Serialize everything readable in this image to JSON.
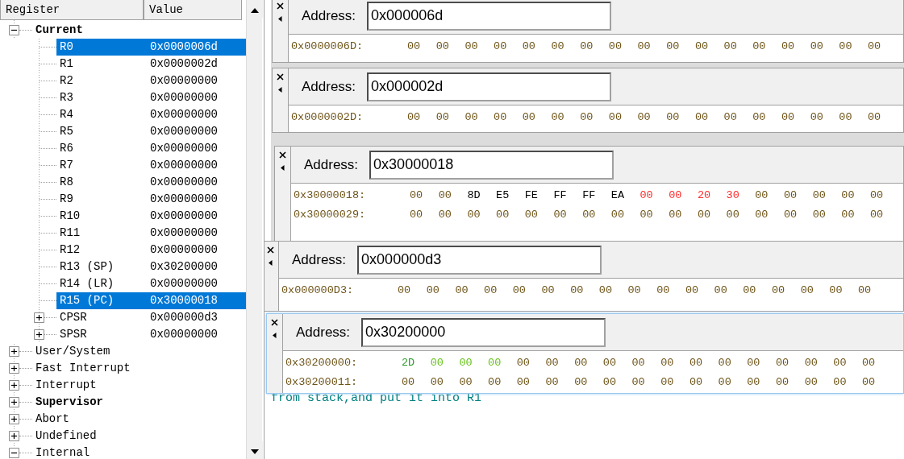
{
  "register_panel": {
    "columns": [
      "Register",
      "Value"
    ],
    "tree": [
      {
        "label": "Current",
        "bold": true,
        "expanded": true,
        "selected": false,
        "children": [
          {
            "label": "R0",
            "value": "0x0000006d",
            "selected": true
          },
          {
            "label": "R1",
            "value": "0x0000002d",
            "selected": false
          },
          {
            "label": "R2",
            "value": "0x00000000",
            "selected": false
          },
          {
            "label": "R3",
            "value": "0x00000000",
            "selected": false
          },
          {
            "label": "R4",
            "value": "0x00000000",
            "selected": false
          },
          {
            "label": "R5",
            "value": "0x00000000",
            "selected": false
          },
          {
            "label": "R6",
            "value": "0x00000000",
            "selected": false
          },
          {
            "label": "R7",
            "value": "0x00000000",
            "selected": false
          },
          {
            "label": "R8",
            "value": "0x00000000",
            "selected": false
          },
          {
            "label": "R9",
            "value": "0x00000000",
            "selected": false
          },
          {
            "label": "R10",
            "value": "0x00000000",
            "selected": false
          },
          {
            "label": "R11",
            "value": "0x00000000",
            "selected": false
          },
          {
            "label": "R12",
            "value": "0x00000000",
            "selected": false
          },
          {
            "label": "R13 (SP)",
            "value": "0x30200000",
            "selected": false
          },
          {
            "label": "R14 (LR)",
            "value": "0x00000000",
            "selected": false
          },
          {
            "label": "R15 (PC)",
            "value": "0x30000018",
            "selected": true
          },
          {
            "label": "CPSR",
            "value": "0x000000d3",
            "selected": false,
            "expanded": false
          },
          {
            "label": "SPSR",
            "value": "0x00000000",
            "selected": false,
            "expanded": false
          }
        ]
      },
      {
        "label": "User/System",
        "bold": false,
        "expanded": false,
        "selected": false
      },
      {
        "label": "Fast Interrupt",
        "bold": false,
        "expanded": false,
        "selected": false
      },
      {
        "label": "Interrupt",
        "bold": false,
        "expanded": false,
        "selected": false
      },
      {
        "label": "Supervisor",
        "bold": true,
        "expanded": false,
        "selected": false
      },
      {
        "label": "Abort",
        "bold": false,
        "expanded": false,
        "selected": false
      },
      {
        "label": "Undefined",
        "bold": false,
        "expanded": false,
        "selected": false
      },
      {
        "label": "Internal",
        "bold": false,
        "expanded": true,
        "selected": false
      }
    ]
  },
  "editor": {
    "lines": [
      "from stack,and put it into R1"
    ]
  },
  "memory_windows": [
    {
      "label": "Address:",
      "address": "0x000006d",
      "rows": [
        {
          "address": "0x0000006D:",
          "bytes": [
            {
              "v": "00",
              "color": "#6e5418"
            },
            {
              "v": "00",
              "color": "#6e5418"
            },
            {
              "v": "00",
              "color": "#6e5418"
            },
            {
              "v": "00",
              "color": "#6e5418"
            },
            {
              "v": "00",
              "color": "#6e5418"
            },
            {
              "v": "00",
              "color": "#6e5418"
            },
            {
              "v": "00",
              "color": "#6e5418"
            },
            {
              "v": "00",
              "color": "#6e5418"
            },
            {
              "v": "00",
              "color": "#6e5418"
            },
            {
              "v": "00",
              "color": "#6e5418"
            },
            {
              "v": "00",
              "color": "#6e5418"
            },
            {
              "v": "00",
              "color": "#6e5418"
            },
            {
              "v": "00",
              "color": "#6e5418"
            },
            {
              "v": "00",
              "color": "#6e5418"
            },
            {
              "v": "00",
              "color": "#6e5418"
            },
            {
              "v": "00",
              "color": "#6e5418"
            },
            {
              "v": "00",
              "color": "#6e5418"
            }
          ]
        }
      ]
    },
    {
      "label": "Address:",
      "address": "0x000002d",
      "rows": [
        {
          "address": "0x0000002D:",
          "bytes": [
            {
              "v": "00",
              "color": "#6e5418"
            },
            {
              "v": "00",
              "color": "#6e5418"
            },
            {
              "v": "00",
              "color": "#6e5418"
            },
            {
              "v": "00",
              "color": "#6e5418"
            },
            {
              "v": "00",
              "color": "#6e5418"
            },
            {
              "v": "00",
              "color": "#6e5418"
            },
            {
              "v": "00",
              "color": "#6e5418"
            },
            {
              "v": "00",
              "color": "#6e5418"
            },
            {
              "v": "00",
              "color": "#6e5418"
            },
            {
              "v": "00",
              "color": "#6e5418"
            },
            {
              "v": "00",
              "color": "#6e5418"
            },
            {
              "v": "00",
              "color": "#6e5418"
            },
            {
              "v": "00",
              "color": "#6e5418"
            },
            {
              "v": "00",
              "color": "#6e5418"
            },
            {
              "v": "00",
              "color": "#6e5418"
            },
            {
              "v": "00",
              "color": "#6e5418"
            },
            {
              "v": "00",
              "color": "#6e5418"
            }
          ]
        }
      ]
    },
    {
      "label": "Address:",
      "address": "0x30000018",
      "rows": [
        {
          "address": "0x30000018:",
          "bytes": [
            {
              "v": "00",
              "color": "#6e5418"
            },
            {
              "v": "00",
              "color": "#6e5418"
            },
            {
              "v": "8D",
              "color": "#000000"
            },
            {
              "v": "E5",
              "color": "#000000"
            },
            {
              "v": "FE",
              "color": "#000000"
            },
            {
              "v": "FF",
              "color": "#000000"
            },
            {
              "v": "FF",
              "color": "#000000"
            },
            {
              "v": "EA",
              "color": "#000000"
            },
            {
              "v": "00",
              "color": "#ff2a2a"
            },
            {
              "v": "00",
              "color": "#ff2a2a"
            },
            {
              "v": "20",
              "color": "#ff2a2a"
            },
            {
              "v": "30",
              "color": "#ff2a2a"
            },
            {
              "v": "00",
              "color": "#6e5418"
            },
            {
              "v": "00",
              "color": "#6e5418"
            },
            {
              "v": "00",
              "color": "#6e5418"
            },
            {
              "v": "00",
              "color": "#6e5418"
            },
            {
              "v": "00",
              "color": "#6e5418"
            }
          ]
        },
        {
          "address": "0x30000029:",
          "bytes": [
            {
              "v": "00",
              "color": "#6e5418"
            },
            {
              "v": "00",
              "color": "#6e5418"
            },
            {
              "v": "00",
              "color": "#6e5418"
            },
            {
              "v": "00",
              "color": "#6e5418"
            },
            {
              "v": "00",
              "color": "#6e5418"
            },
            {
              "v": "00",
              "color": "#6e5418"
            },
            {
              "v": "00",
              "color": "#6e5418"
            },
            {
              "v": "00",
              "color": "#6e5418"
            },
            {
              "v": "00",
              "color": "#6e5418"
            },
            {
              "v": "00",
              "color": "#6e5418"
            },
            {
              "v": "00",
              "color": "#6e5418"
            },
            {
              "v": "00",
              "color": "#6e5418"
            },
            {
              "v": "00",
              "color": "#6e5418"
            },
            {
              "v": "00",
              "color": "#6e5418"
            },
            {
              "v": "00",
              "color": "#6e5418"
            },
            {
              "v": "00",
              "color": "#6e5418"
            },
            {
              "v": "00",
              "color": "#6e5418"
            }
          ]
        }
      ]
    },
    {
      "label": "Address:",
      "address": "0x000000d3",
      "rows": [
        {
          "address": "0x000000D3:",
          "bytes": [
            {
              "v": "00",
              "color": "#6e5418"
            },
            {
              "v": "00",
              "color": "#6e5418"
            },
            {
              "v": "00",
              "color": "#6e5418"
            },
            {
              "v": "00",
              "color": "#6e5418"
            },
            {
              "v": "00",
              "color": "#6e5418"
            },
            {
              "v": "00",
              "color": "#6e5418"
            },
            {
              "v": "00",
              "color": "#6e5418"
            },
            {
              "v": "00",
              "color": "#6e5418"
            },
            {
              "v": "00",
              "color": "#6e5418"
            },
            {
              "v": "00",
              "color": "#6e5418"
            },
            {
              "v": "00",
              "color": "#6e5418"
            },
            {
              "v": "00",
              "color": "#6e5418"
            },
            {
              "v": "00",
              "color": "#6e5418"
            },
            {
              "v": "00",
              "color": "#6e5418"
            },
            {
              "v": "00",
              "color": "#6e5418"
            },
            {
              "v": "00",
              "color": "#6e5418"
            },
            {
              "v": "00",
              "color": "#6e5418"
            }
          ]
        }
      ]
    },
    {
      "label": "Address:",
      "address": "0x30200000",
      "rows": [
        {
          "address": "0x30200000:",
          "bytes": [
            {
              "v": "2D",
              "color": "#2e9a2e"
            },
            {
              "v": "00",
              "color": "#66c21a"
            },
            {
              "v": "00",
              "color": "#66c21a"
            },
            {
              "v": "00",
              "color": "#66c21a"
            },
            {
              "v": "00",
              "color": "#6e5418"
            },
            {
              "v": "00",
              "color": "#6e5418"
            },
            {
              "v": "00",
              "color": "#6e5418"
            },
            {
              "v": "00",
              "color": "#6e5418"
            },
            {
              "v": "00",
              "color": "#6e5418"
            },
            {
              "v": "00",
              "color": "#6e5418"
            },
            {
              "v": "00",
              "color": "#6e5418"
            },
            {
              "v": "00",
              "color": "#6e5418"
            },
            {
              "v": "00",
              "color": "#6e5418"
            },
            {
              "v": "00",
              "color": "#6e5418"
            },
            {
              "v": "00",
              "color": "#6e5418"
            },
            {
              "v": "00",
              "color": "#6e5418"
            },
            {
              "v": "00",
              "color": "#6e5418"
            }
          ]
        },
        {
          "address": "0x30200011:",
          "bytes": [
            {
              "v": "00",
              "color": "#6e5418"
            },
            {
              "v": "00",
              "color": "#6e5418"
            },
            {
              "v": "00",
              "color": "#6e5418"
            },
            {
              "v": "00",
              "color": "#6e5418"
            },
            {
              "v": "00",
              "color": "#6e5418"
            },
            {
              "v": "00",
              "color": "#6e5418"
            },
            {
              "v": "00",
              "color": "#6e5418"
            },
            {
              "v": "00",
              "color": "#6e5418"
            },
            {
              "v": "00",
              "color": "#6e5418"
            },
            {
              "v": "00",
              "color": "#6e5418"
            },
            {
              "v": "00",
              "color": "#6e5418"
            },
            {
              "v": "00",
              "color": "#6e5418"
            },
            {
              "v": "00",
              "color": "#6e5418"
            },
            {
              "v": "00",
              "color": "#6e5418"
            },
            {
              "v": "00",
              "color": "#6e5418"
            },
            {
              "v": "00",
              "color": "#6e5418"
            },
            {
              "v": "00",
              "color": "#6e5418"
            }
          ]
        }
      ]
    }
  ]
}
